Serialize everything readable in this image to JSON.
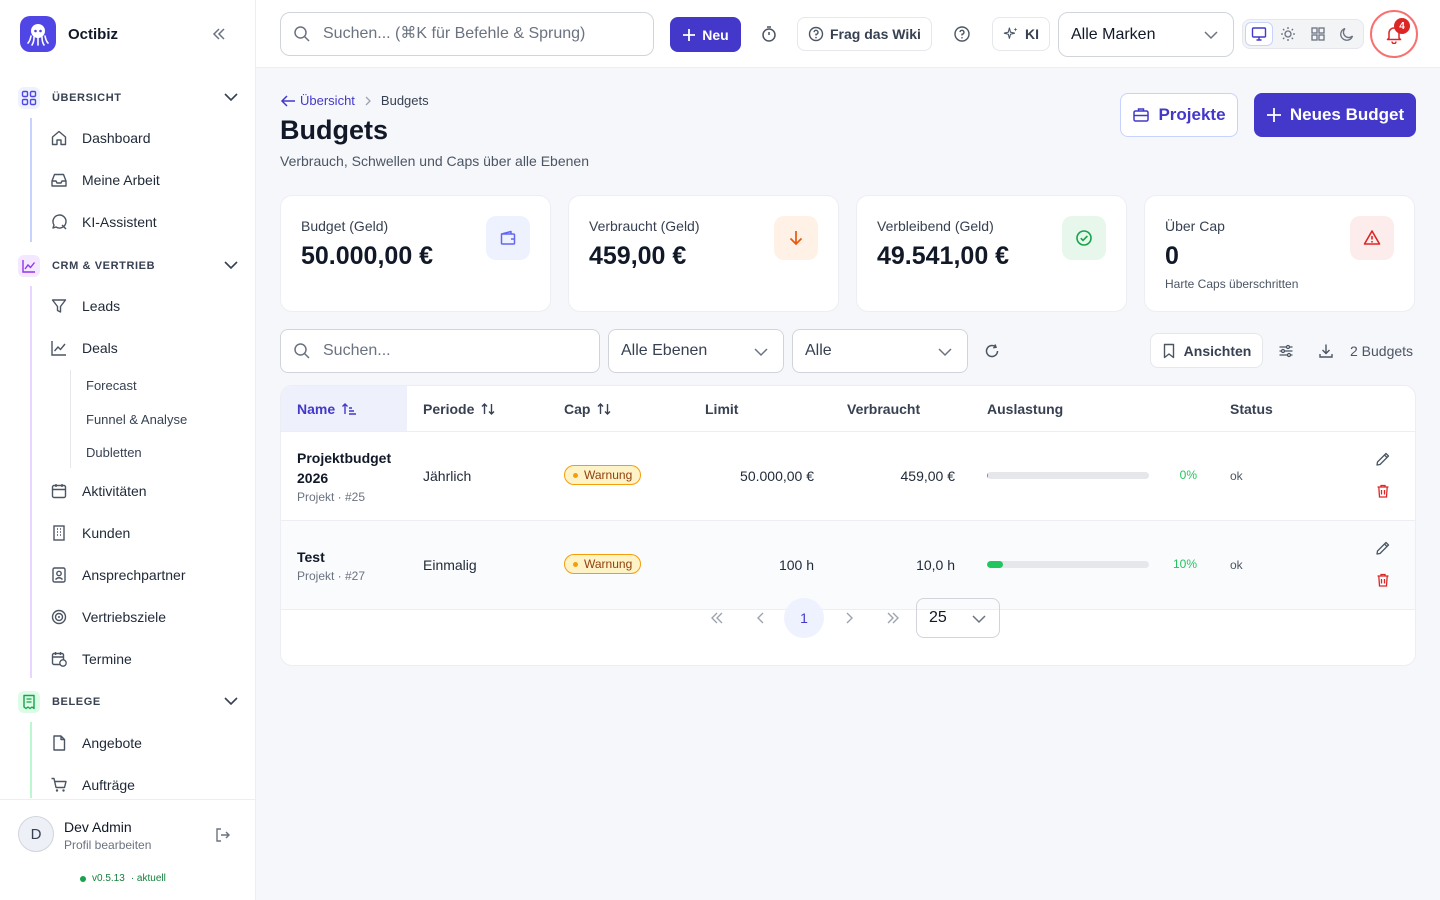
{
  "app": {
    "name": "Octibiz",
    "version": "v0.5.13",
    "version_state": "· aktuell"
  },
  "header": {
    "search_placeholder": "Suchen... (⌘K für Befehle & Sprung)",
    "new_label": "Neu",
    "wiki_label": "Frag das Wiki",
    "ai_label": "KI",
    "brand_select": "Alle Marken",
    "notifications": "4"
  },
  "sidebar": {
    "sections": [
      {
        "label": "ÜBERSICHT",
        "items": [
          "Dashboard",
          "Meine Arbeit",
          "KI-Assistent"
        ]
      },
      {
        "label": "CRM & VERTRIEB",
        "items": [
          "Leads",
          "Deals",
          "Aktivitäten",
          "Kunden",
          "Ansprechpartner",
          "Vertriebsziele",
          "Termine"
        ],
        "deal_subitems": [
          "Forecast",
          "Funnel & Analyse",
          "Dubletten"
        ]
      },
      {
        "label": "BELEGE",
        "items": [
          "Angebote",
          "Aufträge"
        ]
      }
    ],
    "user": {
      "initial": "D",
      "name": "Dev Admin",
      "sub": "Profil bearbeiten"
    }
  },
  "page": {
    "breadcrumb_parent": "Übersicht",
    "breadcrumb_current": "Budgets",
    "title": "Budgets",
    "subtitle": "Verbrauch, Schwellen und Caps über alle Ebenen",
    "btn_projects": "Projekte",
    "btn_new_budget": "Neues Budget"
  },
  "kpis": [
    {
      "label": "Budget (Geld)",
      "value": "50.000,00 €",
      "note": "",
      "color": "#6366f1"
    },
    {
      "label": "Verbraucht (Geld)",
      "value": "459,00 €",
      "note": "",
      "color": "#ea580c"
    },
    {
      "label": "Verbleibend (Geld)",
      "value": "49.541,00 €",
      "note": "",
      "color": "#16a34a"
    },
    {
      "label": "Über Cap",
      "value": "0",
      "note": "Harte Caps überschritten",
      "color": "#dc2626"
    }
  ],
  "filters": {
    "search_placeholder": "Suchen...",
    "level": "Alle Ebenen",
    "status": "Alle",
    "views_label": "Ansichten",
    "count": "2 Budgets"
  },
  "table": {
    "columns": [
      "Name",
      "Periode",
      "Cap",
      "Limit",
      "Verbraucht",
      "Auslastung",
      "Status"
    ],
    "rows": [
      {
        "name": "Projektbudget 2026",
        "sub": "Projekt · #25",
        "period": "Jährlich",
        "cap": "Warnung",
        "limit": "50.000,00 €",
        "used": "459,00 €",
        "utilization": 0.9,
        "pct": "0%",
        "status": "ok"
      },
      {
        "name": "Test",
        "sub": "Projekt · #27",
        "period": "Einmalig",
        "cap": "Warnung",
        "limit": "100 h",
        "used": "10,0 h",
        "utilization": 10,
        "pct": "10%",
        "status": "ok"
      }
    ]
  },
  "pagination": {
    "current": "1",
    "page_size": "25"
  }
}
